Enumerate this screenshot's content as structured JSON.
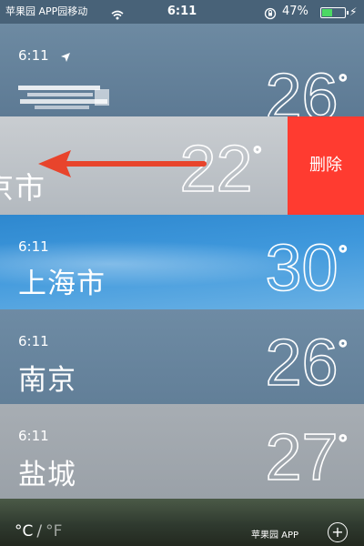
{
  "status_bar": {
    "carrier": "苹果园 APP园移动",
    "time": "6:11",
    "battery_percent": "47%",
    "battery_level": 0.47,
    "icons": [
      "wifi-icon",
      "rotation-lock-icon",
      "battery-icon",
      "charging-icon"
    ]
  },
  "cities": [
    {
      "time": "6:11",
      "name": "",
      "temp": "26",
      "degree": "°",
      "icon": "location-arrow-icon",
      "name_redacted": true
    },
    {
      "time": "",
      "name": "京市",
      "temp": "22",
      "degree": "°",
      "delete_label": "删除"
    },
    {
      "time": "6:11",
      "name": "上海市",
      "temp": "30",
      "degree": "°"
    },
    {
      "time": "6:11",
      "name": "南京",
      "temp": "26",
      "degree": "°"
    },
    {
      "time": "6:11",
      "name": "盐城",
      "temp": "27",
      "degree": "°"
    }
  ],
  "bottom_bar": {
    "celsius": "°C",
    "separator": "/",
    "fahrenheit": "°F",
    "watermark": "苹果园 APP",
    "add_icon": "plus-circle-icon"
  },
  "colors": {
    "delete_red": "#ff3b30",
    "annotation_arrow": "#e8442c",
    "battery_green": "#4cd964"
  }
}
